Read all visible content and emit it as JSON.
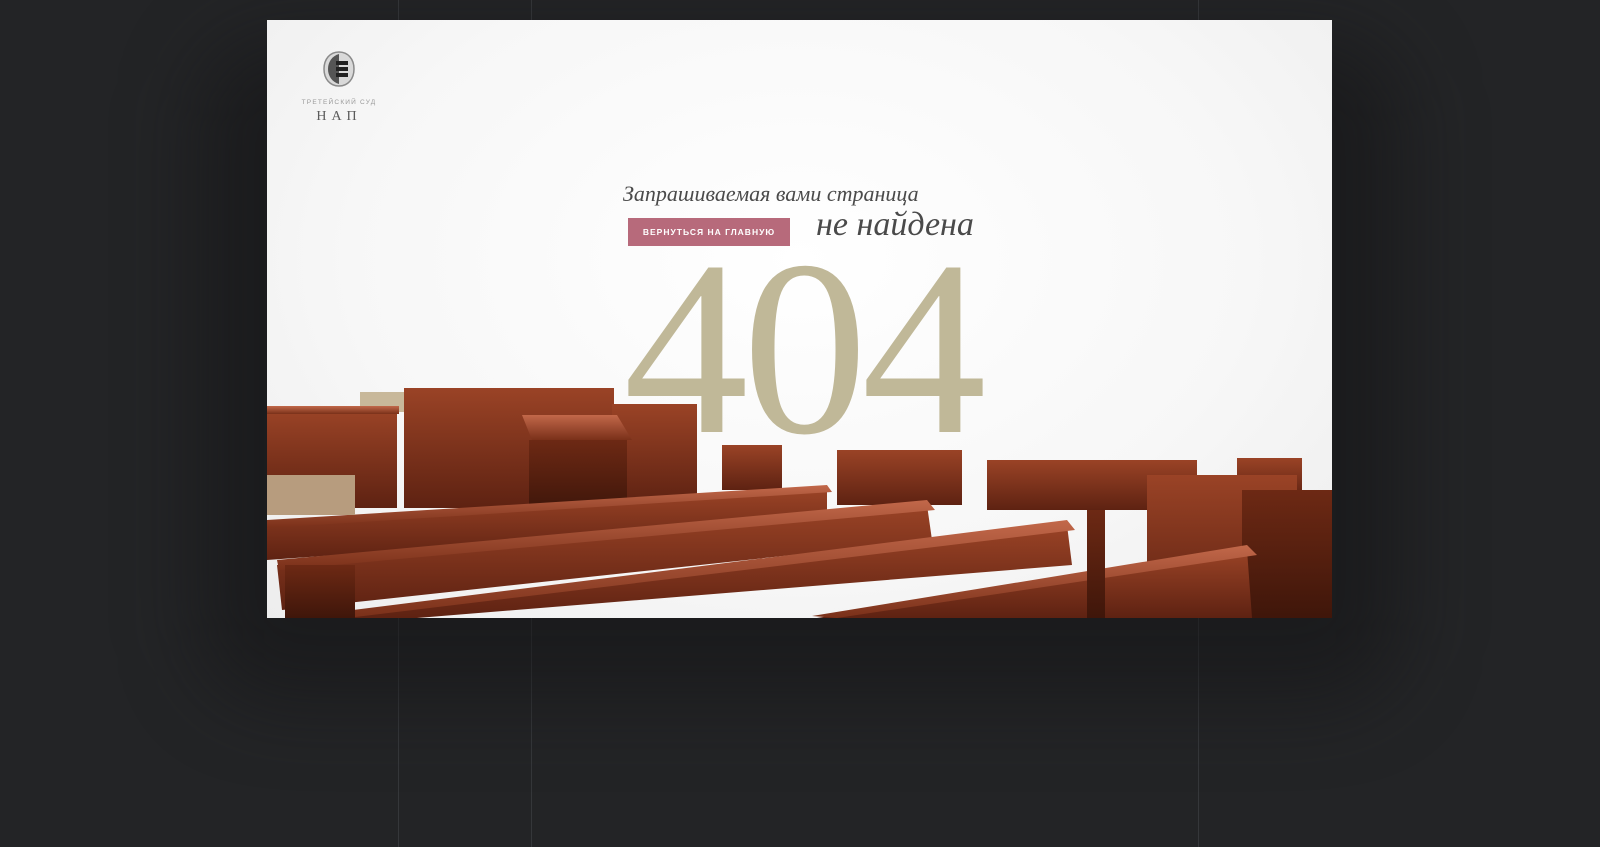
{
  "logo": {
    "subtitle": "ТРЕТЕЙСКИЙ СУД",
    "name": "НАП"
  },
  "message": {
    "line1": "Запрашиваемая вами страница",
    "line2": "не найдена"
  },
  "button": {
    "label": "ВЕРНУТЬСЯ НА ГЛАВНУЮ"
  },
  "error_code": "404",
  "colors": {
    "page_background": "#232426",
    "frame_background": "#fafafa",
    "accent_button": "#b76a7b",
    "code_color": "#c0b898",
    "wood": "#7a2e18"
  }
}
